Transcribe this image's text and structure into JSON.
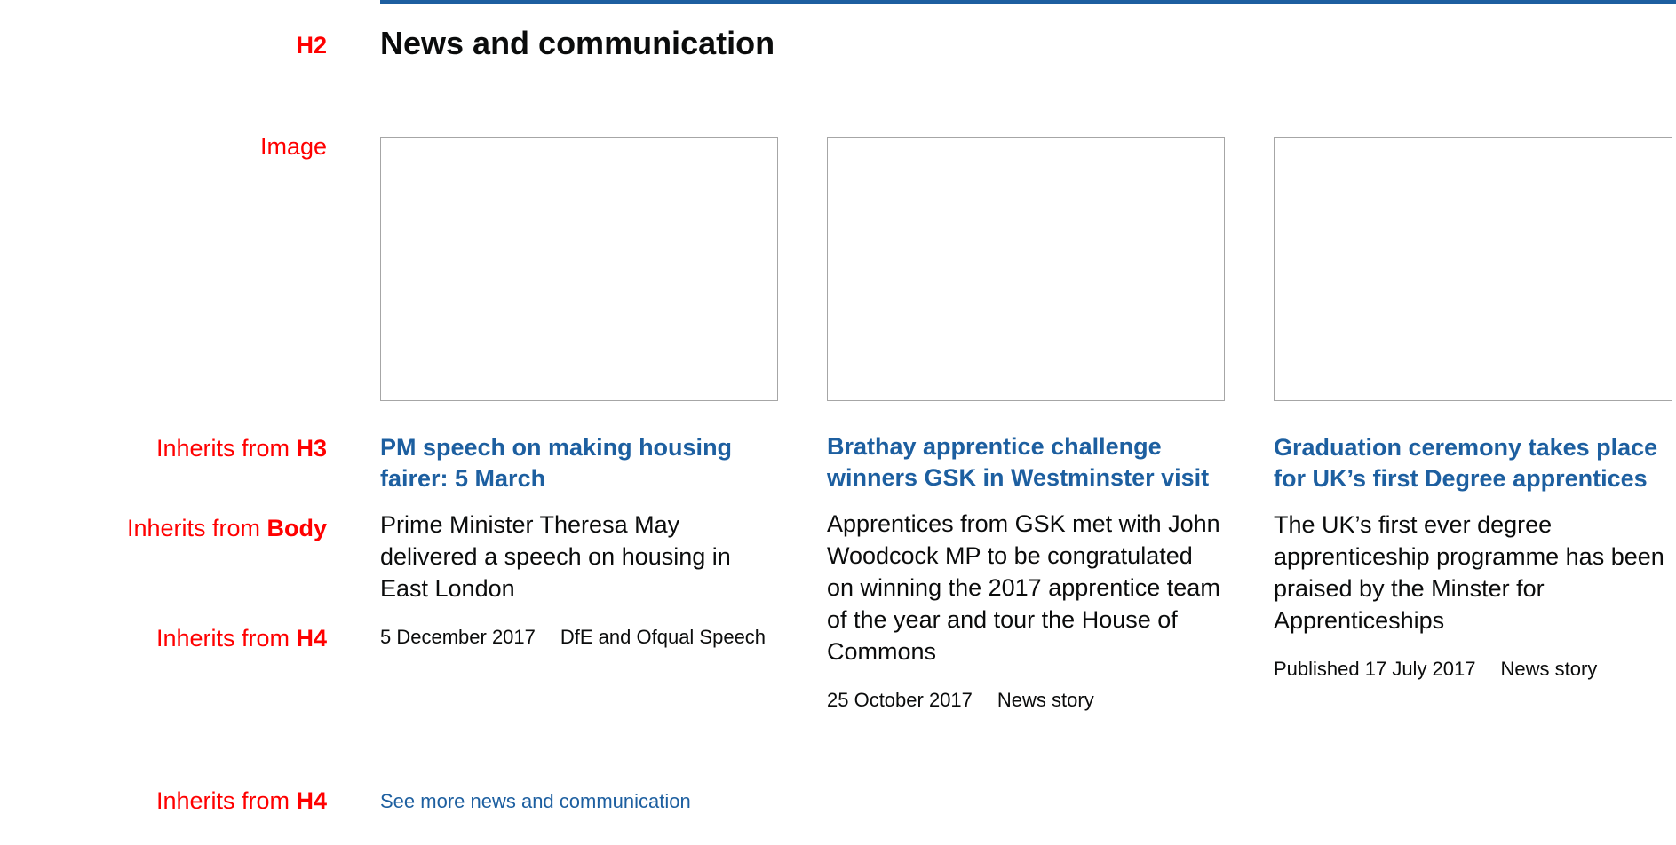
{
  "annotations": {
    "h2": "H2",
    "image": "Image",
    "h3": {
      "prefix": "Inherits from ",
      "tag": "H3"
    },
    "body": {
      "prefix": "Inherits from ",
      "tag": "Body"
    },
    "h4_meta": {
      "prefix": "Inherits from ",
      "tag": "H4"
    },
    "h4_link": {
      "prefix": "Inherits from ",
      "tag": "H4"
    }
  },
  "section": {
    "heading": "News and communication",
    "see_more": "See more news and communication"
  },
  "cards": [
    {
      "title": "PM speech on making housing fairer: 5 March",
      "summary": "Prime Minister Theresa May delivered a speech on housing in East London",
      "date": "5 December 2017",
      "meta": "DfE and Ofqual Speech"
    },
    {
      "title": "Brathay apprentice challenge winners GSK in Westminster visit",
      "summary": "Apprentices from GSK met with John Woodcock MP to be congratulated on winning the 2017 apprentice team of the year and tour the House of Commons",
      "date": "25 October 2017",
      "meta": "News story"
    },
    {
      "title": "Graduation ceremony takes place for UK’s first Degree apprentices",
      "summary": "The UK’s first ever degree apprenticeship programme has been praised by the Minster for Apprenticeships",
      "date": "Published 17 July 2017",
      "meta": "News story"
    }
  ],
  "colors": {
    "annotation": "#ff0000",
    "link": "#1d5fa0",
    "rule": "#1d5fa0",
    "text": "#0b0c0c",
    "image_border": "#a6a6a6"
  }
}
